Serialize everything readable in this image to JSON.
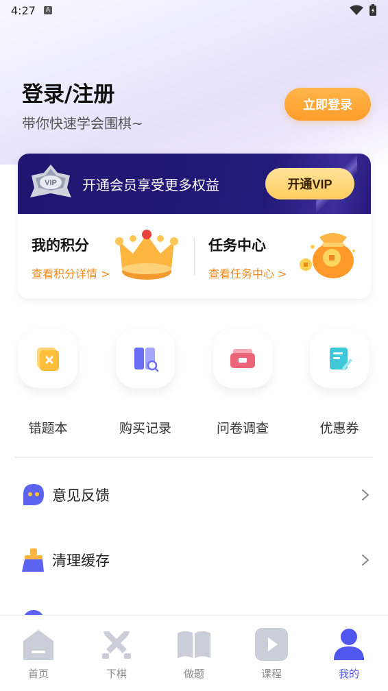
{
  "status": {
    "time": "4:27",
    "a_badge": "A"
  },
  "header": {
    "title": "登录/注册",
    "subtitle": "带你快速学会围棋~",
    "login_button": "立即登录"
  },
  "vip": {
    "badge_text": "VIP",
    "promo_text": "开通会员享受更多权益",
    "button": "开通VIP"
  },
  "points": {
    "title": "我的积分",
    "link": "查看积分详情 >"
  },
  "tasks": {
    "title": "任务中心",
    "link": "查看任务中心 >"
  },
  "grid": [
    {
      "label": "错题本",
      "icon": "wrong-book-icon",
      "color": "#ffc23d"
    },
    {
      "label": "购买记录",
      "icon": "purchase-record-icon",
      "color": "#6a6ef5"
    },
    {
      "label": "问卷调查",
      "icon": "survey-icon",
      "color": "#f06a80"
    },
    {
      "label": "优惠券",
      "icon": "coupon-icon",
      "color": "#3ec8d8"
    }
  ],
  "menu": [
    {
      "label": "意见反馈",
      "icon": "feedback-icon"
    },
    {
      "label": "清理缓存",
      "icon": "broom-icon"
    }
  ],
  "tabs": [
    {
      "label": "首页",
      "icon": "home-icon",
      "active": false
    },
    {
      "label": "下棋",
      "icon": "swords-icon",
      "active": false
    },
    {
      "label": "做题",
      "icon": "book-icon",
      "active": false
    },
    {
      "label": "课程",
      "icon": "play-icon",
      "active": false
    },
    {
      "label": "我的",
      "icon": "user-icon",
      "active": true
    }
  ],
  "colors": {
    "accent": "#4f57ef",
    "orange": "#ff9d2a",
    "vip_bg": "#1e1670",
    "link_orange": "#f08a1d"
  }
}
